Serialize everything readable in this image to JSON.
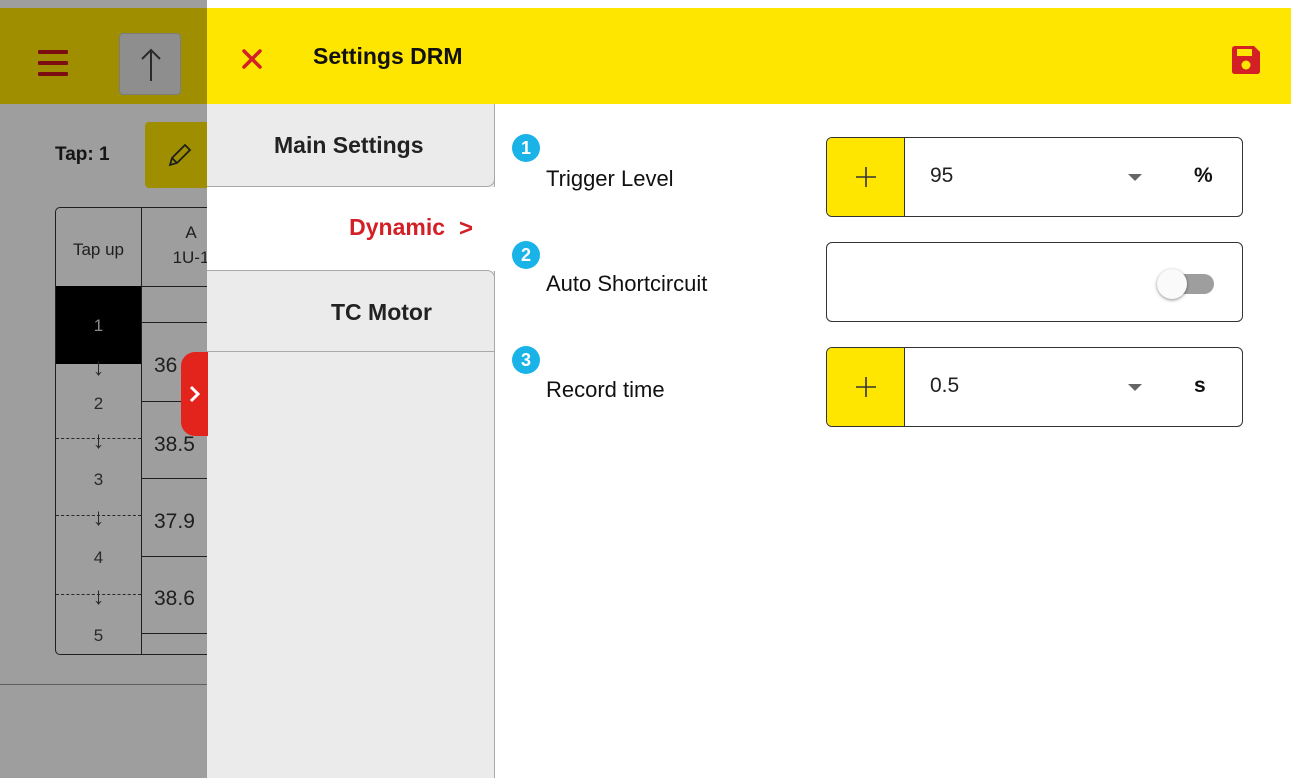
{
  "background_app": {
    "tap_label": "Tap: 1",
    "table": {
      "headers": [
        "Tap up",
        "A",
        "1U-1"
      ],
      "tap_numbers": [
        "1",
        "2",
        "3",
        "4",
        "5"
      ],
      "values": [
        "36",
        "38.5",
        "37.9",
        "38.6"
      ]
    }
  },
  "panel": {
    "title": "Settings DRM",
    "tabs": [
      {
        "label": "Main Settings",
        "active": false
      },
      {
        "label": "Dynamic",
        "active": true
      },
      {
        "label": "TC Motor",
        "active": false
      }
    ],
    "rows": [
      {
        "badge": "1",
        "label": "Trigger Level",
        "value": "95",
        "unit": "%"
      },
      {
        "badge": "2",
        "label": "Auto Shortcircuit",
        "toggle": false
      },
      {
        "badge": "3",
        "label": "Record time",
        "value": "0.5",
        "unit": "s"
      }
    ]
  },
  "icons": {
    "close": "close-icon",
    "save": "floppy-disk-icon",
    "plus": "plus-icon",
    "chevron": "chevron-right-icon",
    "menu": "hamburger-menu-icon",
    "upload": "arrow-up-icon",
    "edit": "pencil-icon"
  },
  "colors": {
    "header_yellow": "#ffe600",
    "accent_red": "#d32027",
    "badge_blue": "#1ab3e8"
  }
}
